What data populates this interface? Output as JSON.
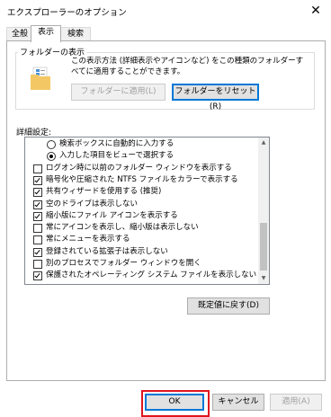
{
  "window": {
    "title": "エクスプローラーのオプション",
    "close_glyph": "✕"
  },
  "tabs": [
    {
      "label": "全般"
    },
    {
      "label": "表示"
    },
    {
      "label": "検索"
    }
  ],
  "folder_view": {
    "group_label": "フォルダーの表示",
    "description": "この表示方法 (詳細表示やアイコンなど) をこの種類のフォルダーすべてに適用することができます。",
    "apply_label": "フォルダーに適用(L)",
    "reset_label": "フォルダーをリセット(R)"
  },
  "advanced": {
    "label": "詳細設定:",
    "items": [
      {
        "type": "radio",
        "checked": false,
        "indent": 2,
        "label": "検索ボックスに自動的に入力する"
      },
      {
        "type": "radio",
        "checked": true,
        "indent": 2,
        "label": "入力した項目をビューで選択する"
      },
      {
        "type": "checkbox",
        "checked": false,
        "indent": 1,
        "label": "ログオン時に以前のフォルダー ウィンドウを表示する"
      },
      {
        "type": "checkbox",
        "checked": true,
        "indent": 1,
        "label": "暗号化や圧縮された NTFS ファイルをカラーで表示する"
      },
      {
        "type": "checkbox",
        "checked": true,
        "indent": 1,
        "label": "共有ウィザードを使用する (推奨)"
      },
      {
        "type": "checkbox",
        "checked": true,
        "indent": 1,
        "label": "空のドライブは表示しない"
      },
      {
        "type": "checkbox",
        "checked": true,
        "indent": 1,
        "label": "縮小版にファイル アイコンを表示する"
      },
      {
        "type": "checkbox",
        "checked": false,
        "indent": 1,
        "label": "常にアイコンを表示し、縮小版は表示しない"
      },
      {
        "type": "checkbox",
        "checked": false,
        "indent": 1,
        "label": "常にメニューを表示する"
      },
      {
        "type": "checkbox",
        "checked": true,
        "indent": 1,
        "label": "登録されている拡張子は表示しない"
      },
      {
        "type": "checkbox",
        "checked": false,
        "indent": 1,
        "label": "別のプロセスでフォルダー ウィンドウを開く"
      },
      {
        "type": "checkbox",
        "checked": true,
        "indent": 1,
        "label": "保護されたオペレーティング システム ファイルを表示しない (推奨)"
      }
    ]
  },
  "restore_defaults_label": "既定値に戻す(D)",
  "footer": {
    "ok_label": "OK",
    "cancel_label": "キャンセル",
    "apply_label": "適用(A)"
  },
  "colors": {
    "highlight": "#e0141e",
    "focus": "#0078d7"
  }
}
